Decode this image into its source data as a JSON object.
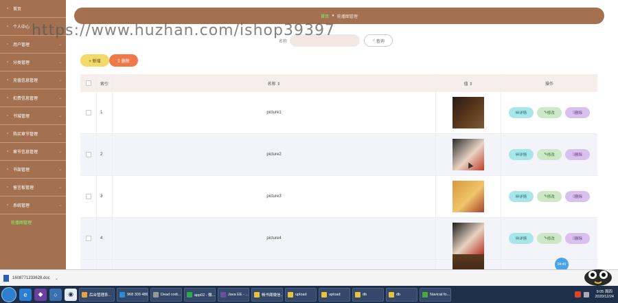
{
  "sidebar": {
    "items": [
      {
        "label": "首页",
        "icon": "home-icon",
        "chevron": false
      },
      {
        "label": "个人中心",
        "icon": "user-icon",
        "chevron": true
      },
      {
        "label": "用户管理",
        "icon": "users-icon",
        "chevron": true
      },
      {
        "label": "分类管理",
        "icon": "category-icon",
        "chevron": true
      },
      {
        "label": "充值信息管理",
        "icon": "recharge-icon",
        "chevron": true
      },
      {
        "label": "扣费信息管理",
        "icon": "fee-icon",
        "chevron": true
      },
      {
        "label": "书城管理",
        "icon": "book-icon",
        "chevron": true
      },
      {
        "label": "购买章节管理",
        "icon": "cart-icon",
        "chevron": true
      },
      {
        "label": "章节信息管理",
        "icon": "chapter-icon",
        "chevron": true
      },
      {
        "label": "书架管理",
        "icon": "shelf-icon",
        "chevron": true
      },
      {
        "label": "留言板管理",
        "icon": "message-icon",
        "chevron": true
      },
      {
        "label": "系统管理",
        "icon": "settings-icon",
        "chevron": true
      }
    ],
    "active_sub": "轮播图管理"
  },
  "breadcrumb": {
    "home": "首页",
    "separator": "●",
    "current": "轮播图管理"
  },
  "search": {
    "label": "名称",
    "placeholder": "",
    "button": "查询"
  },
  "toolbar": {
    "add": "+ 新增",
    "delete": "删除"
  },
  "watermark": "https://www.huzhan.com/ishop39397",
  "table": {
    "headers": {
      "index": "索引",
      "name": "名称 ⇕",
      "value": "值 ⇕",
      "ops": "操作"
    },
    "rows": [
      {
        "index": "1",
        "name": "picture1",
        "thumb_colors": [
          "#2a1a14",
          "#5c3a1e",
          "#7a5b36"
        ]
      },
      {
        "index": "2",
        "name": "picture2",
        "thumb_colors": [
          "#2b2b2b",
          "#e8d3c4",
          "#c23a2a"
        ]
      },
      {
        "index": "3",
        "name": "picture3",
        "thumb_colors": [
          "#d6973c",
          "#f0c46a",
          "#a8402a"
        ]
      },
      {
        "index": "4",
        "name": "picture4",
        "thumb_colors": [
          "#1c1c1c",
          "#e6d2c2",
          "#b83426"
        ]
      }
    ],
    "ops": {
      "detail": "详情",
      "edit": "修改",
      "delete": "删除"
    }
  },
  "float_button": "04:40",
  "download": {
    "filename": "1608771233628.doc"
  },
  "taskbar": {
    "items": [
      {
        "label": "后台管理系...",
        "color": "#e8a23a"
      },
      {
        "label": "968 309 486",
        "color": "#2d8ad6"
      },
      {
        "label": "Dead codi...",
        "color": "#999999"
      },
      {
        "label": "app02 - 微...",
        "color": "#2fa84f"
      },
      {
        "label": "Java EE - ...",
        "color": "#6a4fa0"
      },
      {
        "label": "畅书阁微信...",
        "color": "#e8c23a"
      },
      {
        "label": "upload",
        "color": "#e8c23a"
      },
      {
        "label": "upload",
        "color": "#e8c23a"
      },
      {
        "label": "db",
        "color": "#e8c23a"
      },
      {
        "label": "db",
        "color": "#e8c23a"
      },
      {
        "label": "Navicat fo...",
        "color": "#4fa83a"
      }
    ],
    "time": "9:05 周四",
    "date": "2020/12/24"
  }
}
